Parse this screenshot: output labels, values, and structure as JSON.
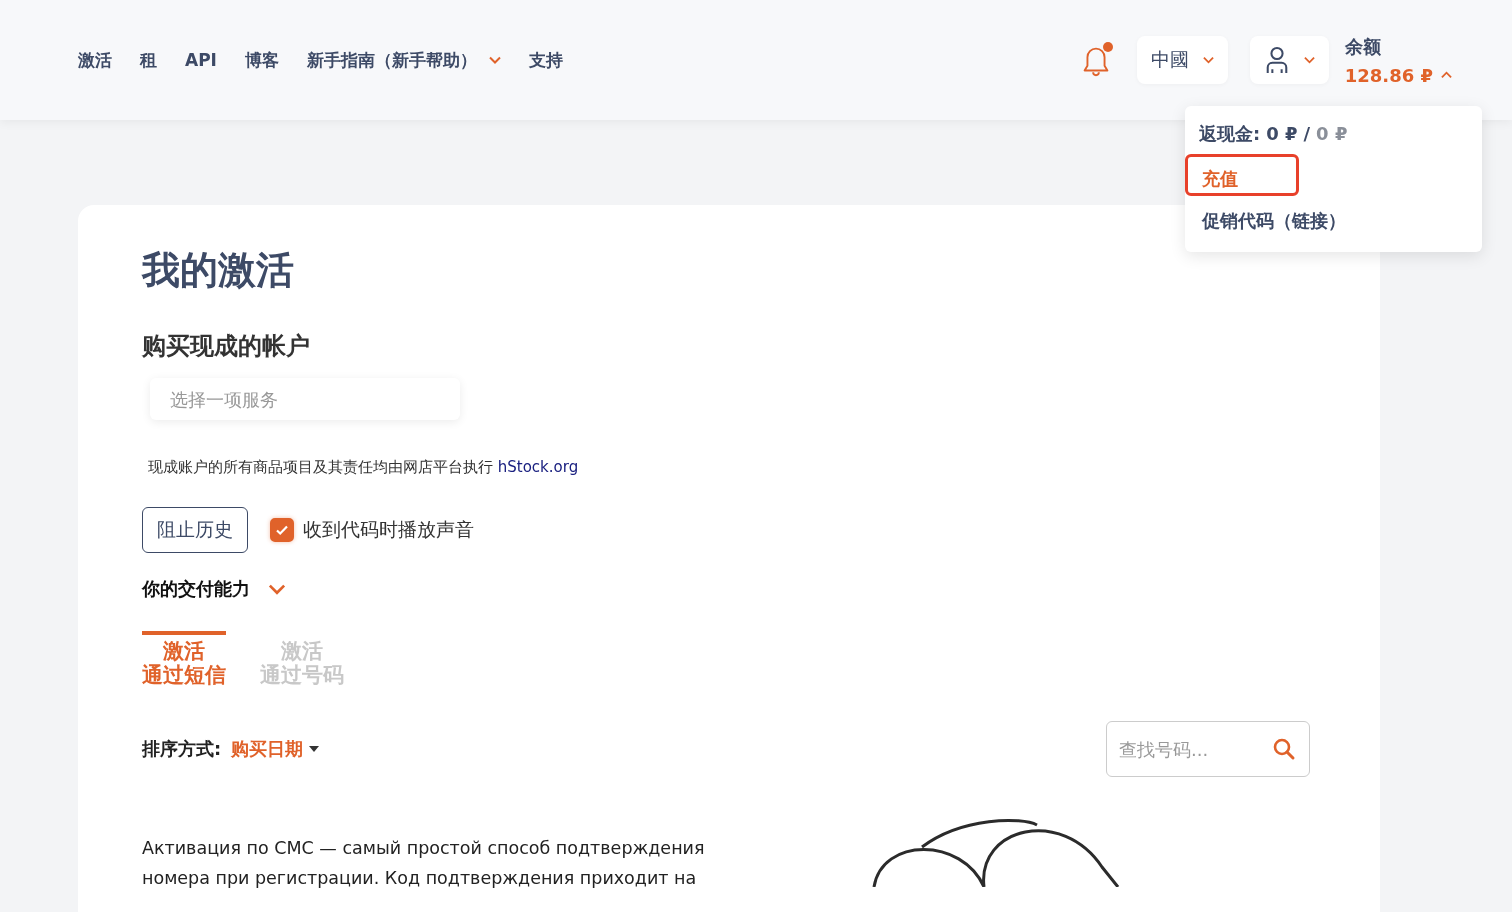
{
  "nav": [
    {
      "label": "激活",
      "kind": "link"
    },
    {
      "label": "租",
      "kind": "link"
    },
    {
      "label": "API",
      "kind": "link"
    },
    {
      "label": "博客",
      "kind": "link"
    },
    {
      "label": "新手指南（新手帮助）",
      "kind": "dropdown"
    },
    {
      "label": "支持",
      "kind": "link"
    }
  ],
  "notifications": {
    "unread": true
  },
  "language": {
    "label": "中國"
  },
  "balance": {
    "label": "余额",
    "amount": "128.86 ₽",
    "expanded": true
  },
  "balance_menu": {
    "cashback_label": "返现金:",
    "cashback_value": "0 ₽",
    "separator": "/",
    "cashback_total": "0 ₽",
    "items": [
      {
        "label": "充值",
        "highlighted": true
      },
      {
        "label": "促销代码（链接）",
        "highlighted": false
      }
    ]
  },
  "page": {
    "title": "我的激活",
    "section_title": "购买现成的帐户",
    "service_select": {
      "placeholder": "选择一项服务"
    },
    "note": "现成账户的所有商品项目及其责任均由网店平台执行",
    "note_link": "hStock.org",
    "block_history_button": "阻止历史",
    "sound_checkbox": {
      "label": "收到代码时播放声音",
      "checked": true
    },
    "capabilities": {
      "label": "你的交付能力",
      "expanded": false
    },
    "tabs": [
      {
        "lines": [
          "激活",
          "通过短信"
        ],
        "selected": true
      },
      {
        "lines": [
          "激活",
          "通过号码"
        ],
        "selected": false
      }
    ],
    "sort": {
      "label": "排序方式:",
      "value": "购买日期"
    },
    "search": {
      "placeholder": "查找号码..."
    },
    "description": "Активация по СМС — самый простой способ подтверждения номера при регистрации. Код подтверждения приходит на"
  }
}
